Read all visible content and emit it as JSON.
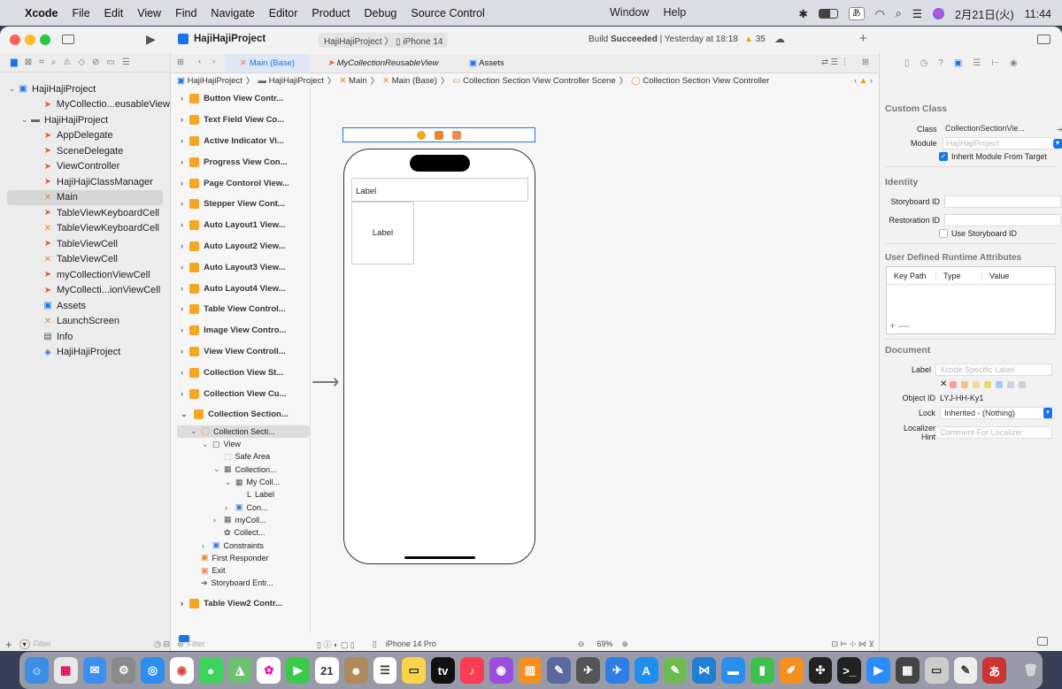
{
  "menubar": {
    "app": "Xcode",
    "items": [
      "File",
      "Edit",
      "View",
      "Find",
      "Navigate",
      "Editor",
      "Product",
      "Debug",
      "Source Control"
    ],
    "right_items": [
      "Window",
      "Help"
    ],
    "input_method": "あ",
    "datetime": "2月21日(火)",
    "time": "11:44"
  },
  "toolbar": {
    "project": "HajiHajiProject",
    "scheme": "HajiHajiProject",
    "device": "iPhone 14",
    "status_prefix": "Build ",
    "status_bold": "Succeeded",
    "status_suffix": " | Yesterday at 18:18",
    "warnings": "35"
  },
  "tabs": [
    "Main (Base)",
    "MyCollectionReusableView",
    "Assets"
  ],
  "breadcrumb": [
    "HajiHajiProject",
    "HajiHajiProject",
    "Main",
    "Main (Base)",
    "Collection Section View Controller Scene",
    "Collection Section View Controller"
  ],
  "navigator": {
    "items": [
      {
        "label": "HajiHajiProject",
        "level": 0,
        "icon": "project-icon",
        "disc": "v"
      },
      {
        "label": "MyCollectio...eusableView",
        "level": 2,
        "icon": "swift-icon",
        "disc": ""
      },
      {
        "label": "HajiHajiProject",
        "level": 1,
        "icon": "folder-icon",
        "disc": "v"
      },
      {
        "label": "AppDelegate",
        "level": 2,
        "icon": "swift-icon",
        "disc": ""
      },
      {
        "label": "SceneDelegate",
        "level": 2,
        "icon": "swift-icon",
        "disc": ""
      },
      {
        "label": "ViewController",
        "level": 2,
        "icon": "swift-icon",
        "disc": ""
      },
      {
        "label": "HajiHajiClassManager",
        "level": 2,
        "icon": "swift-icon",
        "disc": ""
      },
      {
        "label": "Main",
        "level": 2,
        "icon": "storyboard-icon",
        "disc": "",
        "selected": true
      },
      {
        "label": "TableViewKeyboardCell",
        "level": 2,
        "icon": "swift-icon",
        "disc": ""
      },
      {
        "label": "TableViewKeyboardCell",
        "level": 2,
        "icon": "storyboard-icon",
        "disc": ""
      },
      {
        "label": "TableViewCell",
        "level": 2,
        "icon": "swift-icon",
        "disc": ""
      },
      {
        "label": "TableViewCell",
        "level": 2,
        "icon": "storyboard-icon",
        "disc": ""
      },
      {
        "label": "myCollectionViewCell",
        "level": 2,
        "icon": "swift-icon",
        "disc": ""
      },
      {
        "label": "MyCollecti...ionViewCell",
        "level": 2,
        "icon": "swift-icon",
        "disc": ""
      },
      {
        "label": "Assets",
        "level": 2,
        "icon": "assets-icon",
        "disc": ""
      },
      {
        "label": "LaunchScreen",
        "level": 2,
        "icon": "storyboard-icon",
        "disc": ""
      },
      {
        "label": "Info",
        "level": 2,
        "icon": "table-icon",
        "disc": ""
      },
      {
        "label": "HajiHajiProject",
        "level": 2,
        "icon": "package-icon",
        "disc": ""
      }
    ],
    "filter_placeholder": "Filter"
  },
  "outline": {
    "scenes": [
      "Button View Contr...",
      "Text Field View Co...",
      "Active Indicator Vi...",
      "Progress View Con...",
      "Page Contorol View...",
      "Stepper View Cont...",
      "Auto Layout1 View...",
      "Auto Layout2 View...",
      "Auto Layout3 View...",
      "Auto Layout4 View...",
      "Table View Control...",
      "Image View Contro...",
      "View View Controll...",
      "Collection View St...",
      "Collection View Cu...",
      "Collection Section..."
    ],
    "tree": [
      {
        "label": "Collection Secti...",
        "indent": 1,
        "disc": "v",
        "selected": true
      },
      {
        "label": "View",
        "indent": 2,
        "disc": "v"
      },
      {
        "label": "Safe Area",
        "indent": 3,
        "disc": ""
      },
      {
        "label": "Collection...",
        "indent": 3,
        "disc": "v"
      },
      {
        "label": "My Coll...",
        "indent": 4,
        "disc": "v"
      },
      {
        "label": "Label",
        "indent": 5,
        "disc": ""
      },
      {
        "label": "Con...",
        "indent": 4,
        "disc": ">"
      },
      {
        "label": "myColl...",
        "indent": 3,
        "disc": ">"
      },
      {
        "label": "Collect...",
        "indent": 3,
        "disc": ""
      },
      {
        "label": "Constraints",
        "indent": 2,
        "disc": ">"
      },
      {
        "label": "First Responder",
        "indent": 1,
        "disc": ""
      },
      {
        "label": "Exit",
        "indent": 1,
        "disc": ""
      },
      {
        "label": "Storyboard Entr...",
        "indent": 1,
        "disc": ""
      }
    ],
    "last_scene": "Table View2 Contr...",
    "filter_placeholder": "Filter"
  },
  "canvas": {
    "header_label": "Label",
    "cell_label": "Label",
    "device": "iPhone 14 Pro",
    "zoom": "69%"
  },
  "inspector": {
    "custom_class_title": "Custom Class",
    "class_label": "Class",
    "class_value": "CollectionSectionVie...",
    "module_label": "Module",
    "module_placeholder": "HajiHajiProject",
    "inherit_label": "Inherit Module From Target",
    "identity_title": "Identity",
    "storyboard_id_label": "Storyboard ID",
    "restoration_id_label": "Restoration ID",
    "use_storyboard_id": "Use Storyboard ID",
    "udra_title": "User Defined Runtime Attributes",
    "cols": [
      "Key Path",
      "Type",
      "Value"
    ],
    "document_title": "Document",
    "label_label": "Label",
    "label_placeholder": "Xcode Specific Label",
    "object_id_label": "Object ID",
    "object_id": "LYJ-HH-Ky1",
    "lock_label": "Lock",
    "lock_value": "Inherited - (Nothing)",
    "localizer_label": "Localizer Hint",
    "localizer_placeholder": "Comment For Localizer"
  },
  "colors": {
    "accent": "#1a74e8",
    "swift": "#f05138",
    "storyboard": "#e8882d"
  }
}
